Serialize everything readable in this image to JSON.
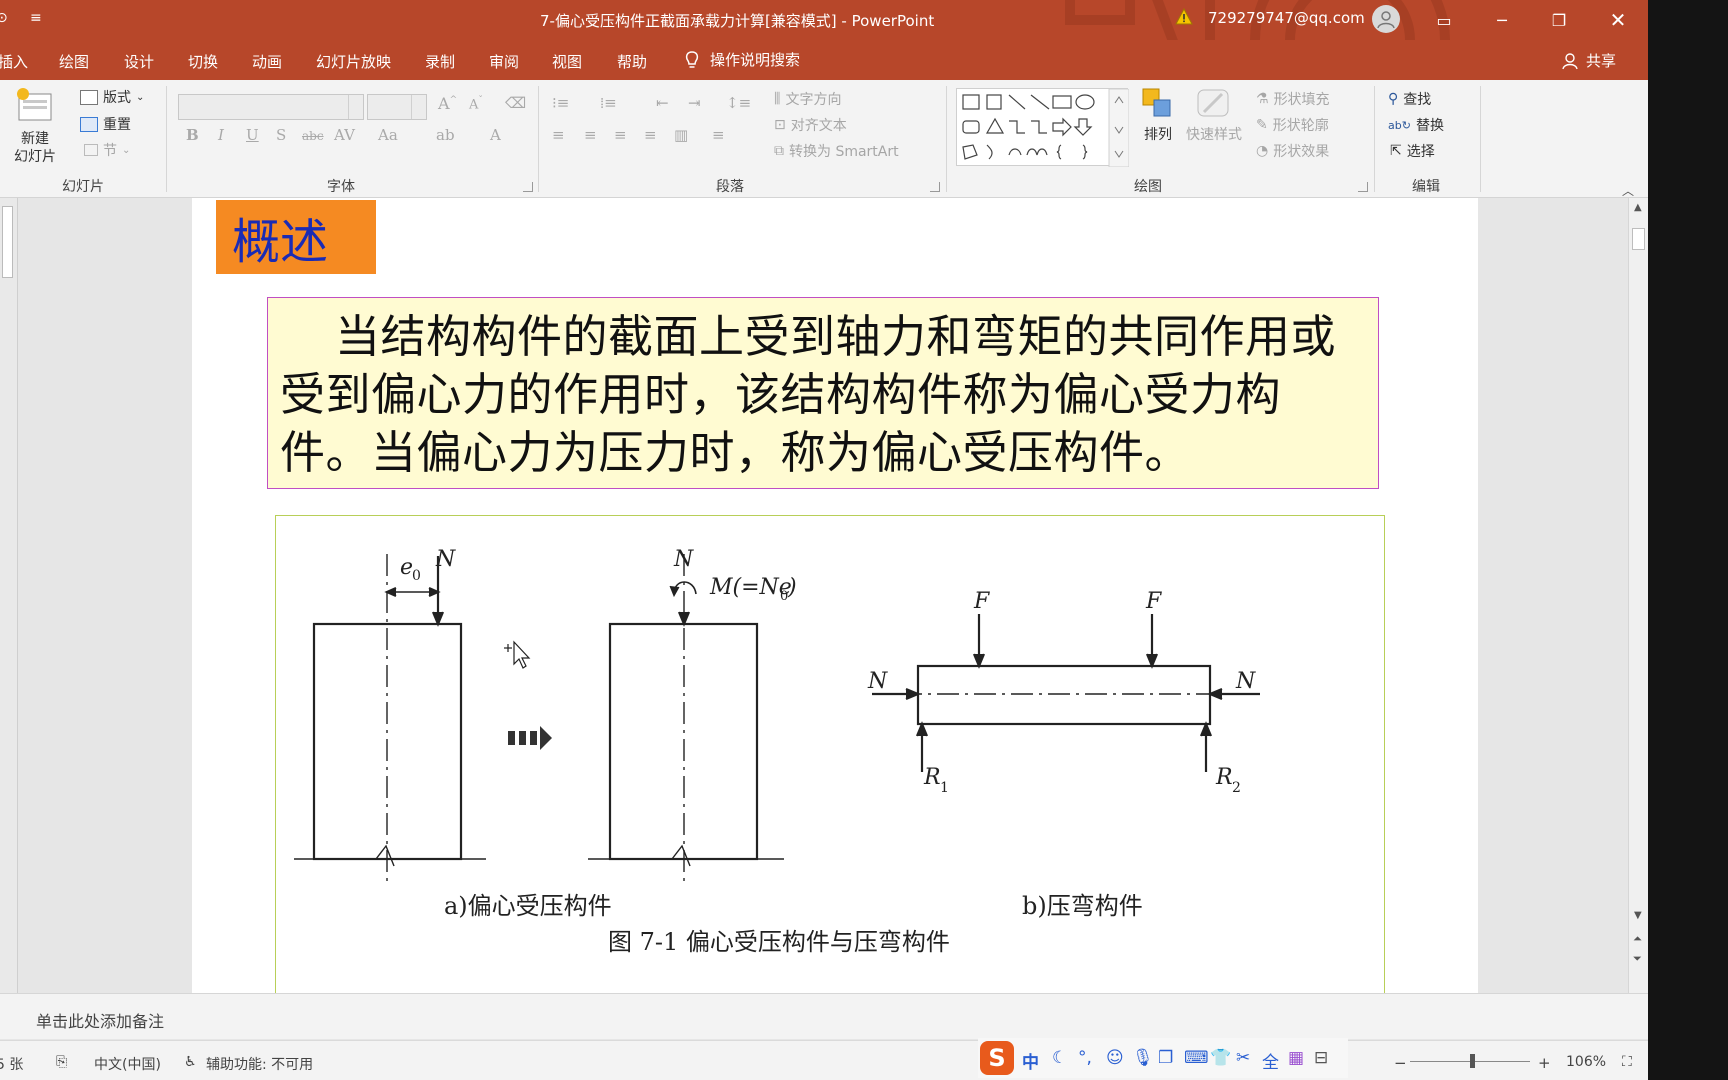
{
  "window": {
    "title": "7-偏心受压构件正截面承载力计算[兼容模式] - PowerPoint",
    "account": "729279747@qq.com",
    "accent_color": "#b7472a"
  },
  "tabs": [
    {
      "label": "插入"
    },
    {
      "label": "绘图"
    },
    {
      "label": "设计"
    },
    {
      "label": "切换"
    },
    {
      "label": "动画"
    },
    {
      "label": "幻灯片放映"
    },
    {
      "label": "录制"
    },
    {
      "label": "审阅"
    },
    {
      "label": "视图"
    },
    {
      "label": "帮助"
    }
  ],
  "tell_me": "操作说明搜索",
  "share": "共享",
  "ribbon": {
    "new_slide_line1": "新建",
    "new_slide_line2": "幻灯片",
    "layout": "版式",
    "reset": "重置",
    "section": "节",
    "groups": {
      "slides": "幻灯片",
      "font": "字体",
      "paragraph": "段落",
      "drawing": "绘图",
      "editing": "编辑"
    },
    "text_direction": "文字方向",
    "align_text": "对齐文本",
    "convert_smartart": "转换为 SmartArt",
    "arrange": "排列",
    "quick_styles": "快速样式",
    "shape_fill": "形状填充",
    "shape_outline": "形状轮廓",
    "shape_effects": "形状效果",
    "find": "查找",
    "replace": "替换",
    "select": "选择"
  },
  "slide": {
    "section_title": "概述",
    "definition": "当结构构件的截面上受到轴力和弯矩的共同作用或受到偏心力的作用时，该结构构件称为偏心受力构件。当偏心力为压力时，称为偏心受压构件。",
    "figure": {
      "label_e0": "e",
      "sub_0": "0",
      "label_N": "N",
      "label_M": "M(=Ne",
      "label_M_close": ")",
      "label_F": "F",
      "label_R": "R",
      "sub_1": "1",
      "sub_2": "2",
      "caption_a": "a)偏心受压构件",
      "caption_b": "b)压弯构件",
      "figure_caption": "图 7-1    偏心受压构件与压弯构件"
    }
  },
  "notes": "单击此处添加备注",
  "status": {
    "slide_count": "5 张",
    "language": "中文(中国)",
    "accessibility": "辅助功能: 不可用",
    "zoom": "106%"
  },
  "ime": {
    "mode": "中"
  }
}
